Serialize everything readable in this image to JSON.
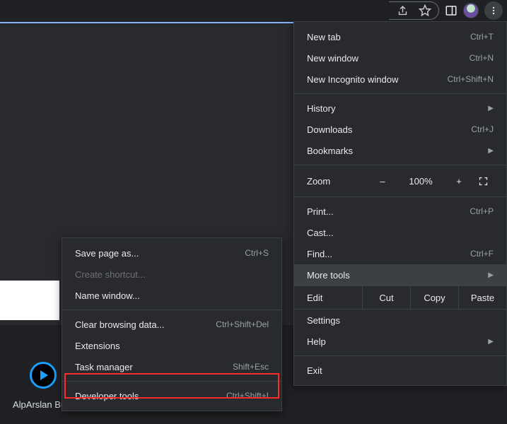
{
  "toolbar": {
    "share_icon": "share-icon",
    "star_icon": "star-icon",
    "panel_icon": "side-panel-icon",
    "avatar": "avatar",
    "more_icon": "more-vert-icon"
  },
  "menu": {
    "new_tab": "New tab",
    "new_tab_sc": "Ctrl+T",
    "new_window": "New window",
    "new_window_sc": "Ctrl+N",
    "new_incognito": "New Incognito window",
    "new_incognito_sc": "Ctrl+Shift+N",
    "history": "History",
    "downloads": "Downloads",
    "downloads_sc": "Ctrl+J",
    "bookmarks": "Bookmarks",
    "zoom_label": "Zoom",
    "zoom_minus": "–",
    "zoom_value": "100%",
    "zoom_plus": "+",
    "print": "Print...",
    "print_sc": "Ctrl+P",
    "cast": "Cast...",
    "find": "Find...",
    "find_sc": "Ctrl+F",
    "more_tools": "More tools",
    "edit_label": "Edit",
    "cut": "Cut",
    "copy": "Copy",
    "paste": "Paste",
    "settings": "Settings",
    "help": "Help",
    "exit": "Exit"
  },
  "submenu": {
    "save_page": "Save page as...",
    "save_page_sc": "Ctrl+S",
    "create_shortcut": "Create shortcut...",
    "name_window": "Name window...",
    "clear_data": "Clear browsing data...",
    "clear_data_sc": "Ctrl+Shift+Del",
    "extensions": "Extensions",
    "task_manager": "Task manager",
    "task_manager_sc": "Shift+Esc",
    "devtools": "Developer tools",
    "devtools_sc": "Ctrl+Shift+I"
  },
  "thumbnail_caption": "AlpArslan Bü..."
}
